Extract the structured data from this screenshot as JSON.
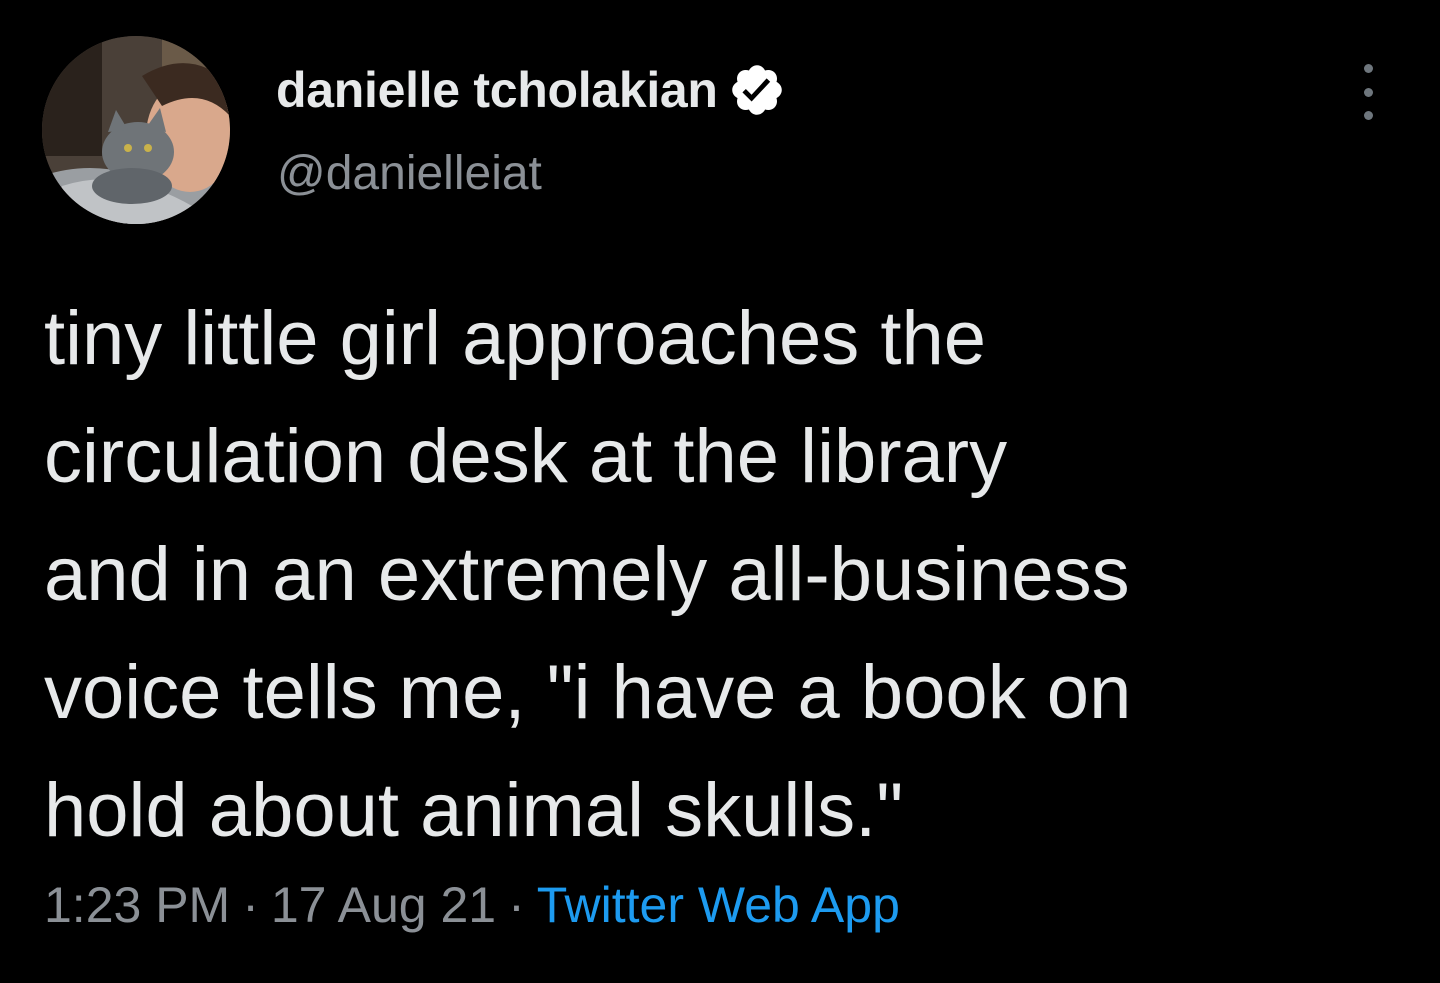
{
  "tweet": {
    "author": {
      "display_name": "danielle tcholakian",
      "handle": "@danielleiat",
      "verified": true,
      "avatar_icon": "profile-photo-with-cat"
    },
    "more_icon": "more-vertical-icon",
    "text_lines": [
      "tiny little girl approaches the",
      "circulation desk at the library",
      "and in an extremely all-business",
      "voice tells me, \"i have a book on",
      "hold about animal skulls.\""
    ],
    "meta": {
      "time": "1:23 PM",
      "separator": "·",
      "date": "17 Aug 21",
      "source": "Twitter Web App"
    }
  },
  "colors": {
    "background": "#000000",
    "primary_text": "#e7e9ea",
    "secondary_text": "#8b9096",
    "link": "#1d9bf0",
    "verified_badge": "#ffffff"
  }
}
